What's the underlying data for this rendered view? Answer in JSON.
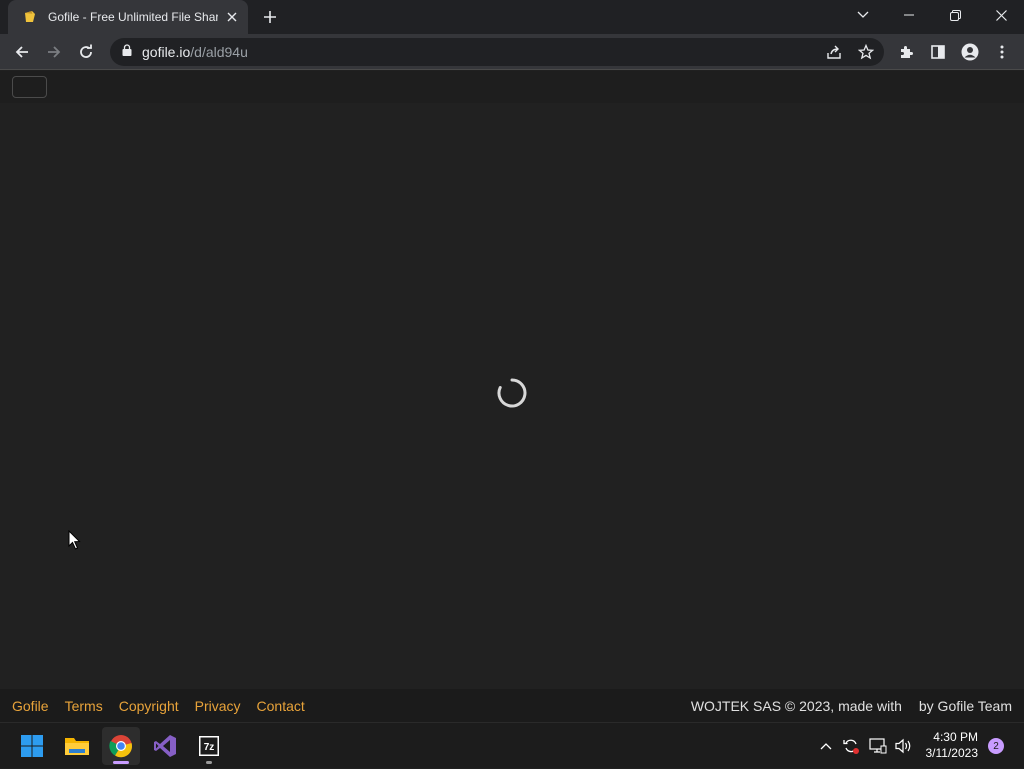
{
  "browser": {
    "tab": {
      "title": "Gofile - Free Unlimited File Sharing"
    },
    "url": {
      "host": "gofile.io",
      "path": "/d/ald94u"
    }
  },
  "footer": {
    "links": [
      "Gofile",
      "Terms",
      "Copyright",
      "Privacy",
      "Contact"
    ],
    "credit_before": "WOJTEK SAS © 2023, made with",
    "credit_after": "by Gofile Team"
  },
  "taskbar": {
    "time": "4:30 PM",
    "date": "3/11/2023",
    "notification_count": "2"
  },
  "colors": {
    "link_color": "#e8a33a",
    "page_background": "#212121",
    "chrome_background": "#202124"
  }
}
